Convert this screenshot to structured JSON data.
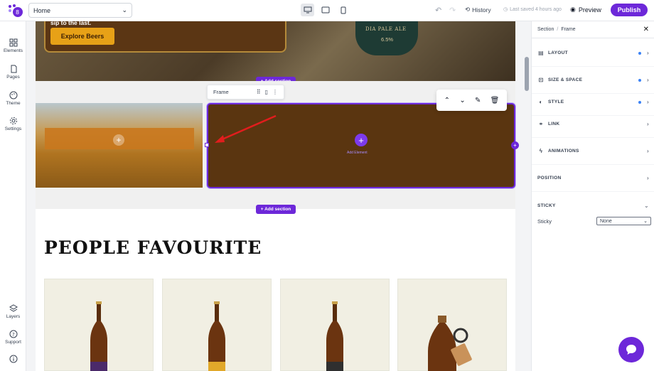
{
  "topbar": {
    "page_select_value": "Home",
    "history_label": "History",
    "saved_status": "Last saved 4 hours ago",
    "preview_label": "Preview",
    "publish_label": "Publish"
  },
  "rail": {
    "items": [
      {
        "label": "Elements"
      },
      {
        "label": "Pages"
      },
      {
        "label": "Theme"
      },
      {
        "label": "Settings"
      },
      {
        "label": "Layers"
      },
      {
        "label": "Support"
      }
    ]
  },
  "canvas": {
    "hero_text": "sip to the last.",
    "explore_button": "Explore Beers",
    "bottle_label": "DIA PALE ALE",
    "bottle_abv": "6.5%",
    "add_section_label": "+ Add section",
    "frame_toolbar_label": "Frame",
    "add_element_label": "Add Element",
    "section_heading": "PEOPLE FAVOURITE"
  },
  "panel": {
    "breadcrumb_root": "Section",
    "breadcrumb_current": "Frame",
    "rows": [
      {
        "label": "LAYOUT"
      },
      {
        "label": "SIZE & SPACE"
      },
      {
        "label": "STYLE"
      },
      {
        "label": "LINK"
      },
      {
        "label": "ANIMATIONS"
      },
      {
        "label": "POSITION"
      },
      {
        "label": "STICKY"
      }
    ],
    "sticky_field_label": "Sticky",
    "sticky_field_value": "None"
  },
  "colors": {
    "accent": "#6d28d9",
    "frame_bg": "#5a3510",
    "cta": "#e7a117"
  }
}
